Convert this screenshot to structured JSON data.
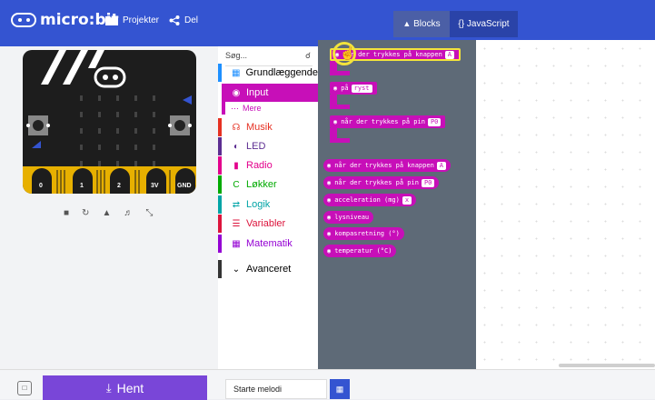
{
  "header": {
    "logo_text": "micro:bit",
    "projects_label": "Projekter",
    "share_label": "Del",
    "blocks_label": "Blocks",
    "javascript_label": "{} JavaScript"
  },
  "simulator": {
    "pins": [
      "0",
      "1",
      "2",
      "3V",
      "GND"
    ],
    "button_a": "A",
    "button_b": "B",
    "tools": [
      "stop-icon",
      "restart-icon",
      "slowmo-icon",
      "mute-icon",
      "fullscreen-icon"
    ]
  },
  "toolbox": {
    "search_placeholder": "Søg...",
    "categories": [
      {
        "label": "Grundlæggende",
        "color": "#1e90ff",
        "icon": "grid-icon"
      },
      {
        "label": "Input",
        "color": "#c70fb8",
        "icon": "radio-icon"
      },
      {
        "label": "Musik",
        "color": "#e63022",
        "icon": "headphones-icon"
      },
      {
        "label": "LED",
        "color": "#5c2d91",
        "icon": "toggle-icon"
      },
      {
        "label": "Radio",
        "color": "#e3008c",
        "icon": "signal-icon"
      },
      {
        "label": "Løkker",
        "color": "#00aa00",
        "icon": "loop-icon"
      },
      {
        "label": "Logik",
        "color": "#00a4a6",
        "icon": "shuffle-icon"
      },
      {
        "label": "Variabler",
        "color": "#dc143c",
        "icon": "lines-icon"
      },
      {
        "label": "Matematik",
        "color": "#9400d3",
        "icon": "calculator-icon"
      },
      {
        "label": "Avanceret",
        "color": "#333333",
        "icon": "chevron-down-icon"
      }
    ],
    "more_label": "Mere"
  },
  "flyout": {
    "blocks": [
      {
        "text": "når der trykkes på knappen",
        "dd": "A",
        "kind": "hat"
      },
      {
        "text": "på",
        "dd": "ryst",
        "kind": "hat"
      },
      {
        "text": "når der trykkes på pin",
        "dd": "P0",
        "kind": "hat"
      },
      {
        "text": "når der trykkes på knappen",
        "dd": "A",
        "kind": "rep"
      },
      {
        "text": "når der trykkes på pin",
        "dd": "P0",
        "kind": "rep"
      },
      {
        "text": "acceleration (mg)",
        "dd": "x",
        "kind": "rep"
      },
      {
        "text": "lysniveau",
        "dd": "",
        "kind": "rep"
      },
      {
        "text": "kompasretning (°)",
        "dd": "",
        "kind": "rep"
      },
      {
        "text": "temperatur (°C)",
        "dd": "",
        "kind": "rep"
      }
    ]
  },
  "footer": {
    "download_label": "Hent",
    "project_name": "Starte melodi"
  }
}
